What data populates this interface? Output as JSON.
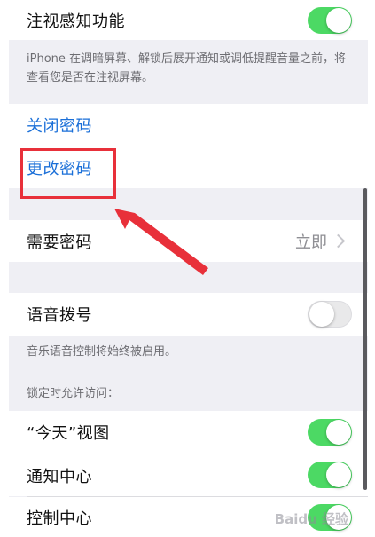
{
  "attention": {
    "label": "注视感知功能",
    "enabled": true,
    "footnote": "iPhone 在调暗屏幕、解锁后展开通知或调低提醒音量之前，将查看您是否在注视屏幕。"
  },
  "passcode": {
    "turn_off_label": "关闭密码",
    "change_label": "更改密码"
  },
  "require_passcode": {
    "label": "需要密码",
    "value": "立即"
  },
  "voice_dial": {
    "label": "语音拨号",
    "enabled": false,
    "footnote": "音乐语音控制将始终被启用。"
  },
  "locked_access": {
    "header": "锁定时允许访问：",
    "items": [
      {
        "label": "“今天”视图",
        "enabled": true
      },
      {
        "label": "通知中心",
        "enabled": true
      },
      {
        "label": "控制中心",
        "enabled": true
      }
    ]
  },
  "colors": {
    "accent_blue": "#1a6fd8",
    "toggle_on": "#4cd964",
    "annotation_red": "#e8303a"
  },
  "watermark": "Baidu 经验"
}
